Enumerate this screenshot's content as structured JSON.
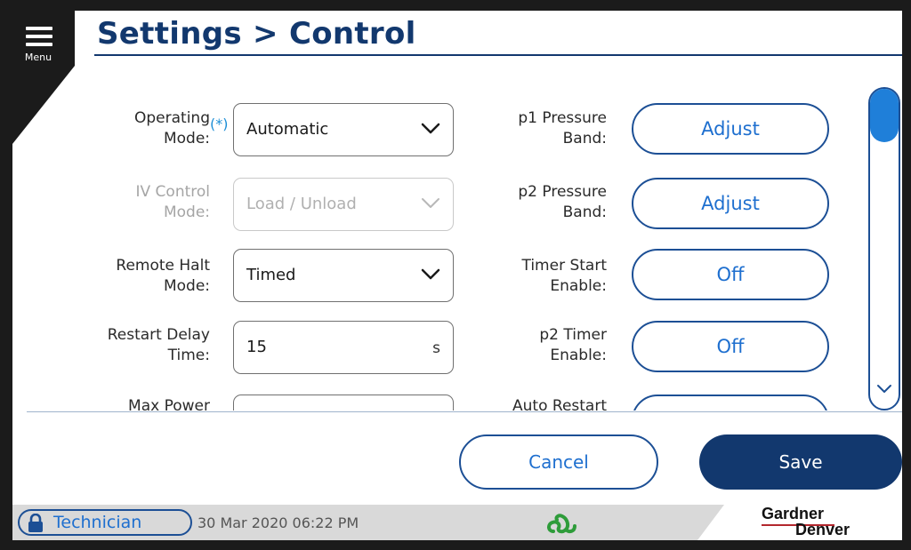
{
  "menu": {
    "label": "Menu"
  },
  "header": {
    "title": "Settings > Control"
  },
  "left_fields": [
    {
      "label_line1": "Operating",
      "label_line2": "Mode:",
      "required_mark": "(*)",
      "value": "Automatic"
    },
    {
      "label_line1": "IV Control",
      "label_line2": "Mode:",
      "value": "Load / Unload",
      "disabled": true
    },
    {
      "label_line1": "Remote Halt",
      "label_line2": "Mode:",
      "value": "Timed"
    },
    {
      "label_line1": "Restart Delay",
      "label_line2": "Time:",
      "value": "15",
      "unit": "s"
    },
    {
      "label_line1": "Max Power",
      "value": ""
    }
  ],
  "right_fields": [
    {
      "label_line1": "p1 Pressure",
      "label_line2": "Band:",
      "button": "Adjust"
    },
    {
      "label_line1": "p2 Pressure",
      "label_line2": "Band:",
      "button": "Adjust"
    },
    {
      "label_line1": "Timer Start",
      "label_line2": "Enable:",
      "button": "Off"
    },
    {
      "label_line1": "p2 Timer",
      "label_line2": "Enable:",
      "button": "Off"
    },
    {
      "label_line1": "Auto Restart",
      "button": ""
    }
  ],
  "actions": {
    "cancel": "Cancel",
    "save": "Save"
  },
  "status_bar": {
    "user_role": "Technician",
    "datetime": "30 Mar 2020  06:22 PM",
    "brand_line1": "Gardner",
    "brand_line2": "Denver"
  },
  "colors": {
    "primary_dark": "#12386e",
    "accent_blue": "#1e6fcf",
    "scroll_thumb": "#1f7fd9",
    "required_mark": "#1e8fd6"
  },
  "scroll": {
    "position_fraction": 0.0
  }
}
